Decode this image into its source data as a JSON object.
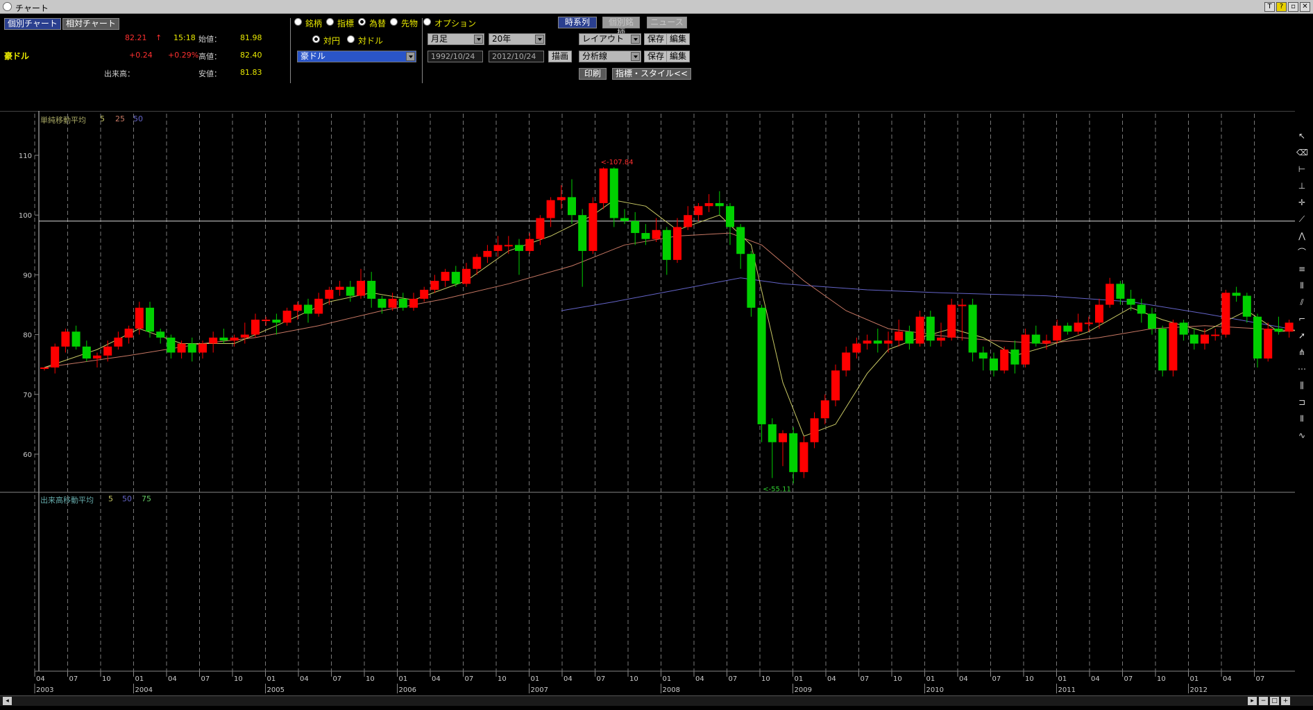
{
  "window": {
    "title": "チャート"
  },
  "tabs": [
    "個別チャート",
    "相対チャート"
  ],
  "quote": {
    "symbol": "豪ドル",
    "price": "82.21",
    "arrow": "↑",
    "time": "15:18",
    "change": "+0.24",
    "change_pct": "+0.29%",
    "volume_label": "出来高：",
    "open_label": "始値：",
    "open": "81.98",
    "high_label": "高値：",
    "high": "82.40",
    "low_label": "安値：",
    "low": "81.83"
  },
  "category_radios": [
    "銘柄",
    "指標",
    "為替",
    "先物",
    "オプション"
  ],
  "currency_radios": [
    "対円",
    "対ドル"
  ],
  "pair_select": "豪ドル",
  "period": {
    "interval": "月足",
    "span": "20年",
    "from": "1992/10/24",
    "to": "2012/10/24",
    "draw": "描画"
  },
  "right_buttons": {
    "timeseries": "時系列",
    "individual": "個別銘柄",
    "news": "ニュース",
    "layout": "レイアウト",
    "save": "保存",
    "edit": "編集",
    "analysis": "分析線",
    "print": "印刷",
    "indicator_style": "指標・スタイル<<"
  },
  "legends": {
    "sma_title": "単純移動平均",
    "sma_periods": [
      "5",
      "25",
      "50"
    ],
    "vol_title": "出来高移動平均",
    "vol_periods": [
      "5",
      "50",
      "75"
    ]
  },
  "annotations": {
    "high": "<-107.84",
    "low": "<-55.11"
  },
  "tools": [
    "cursor-icon",
    "eraser-icon",
    "hline-icon",
    "vline-icon",
    "crosshair-icon",
    "trendline-icon",
    "fan-icon",
    "arc-icon",
    "retracement-icon",
    "cycle-icon",
    "channel-icon",
    "fib-icon",
    "ray-icon",
    "gann-icon",
    "zigzag-icon",
    "time-zone-icon",
    "bracket-icon",
    "split-icon",
    "wave-icon"
  ],
  "chart_data": {
    "type": "candlestick",
    "title": "",
    "y_ticks": [
      110,
      100,
      90,
      80,
      70,
      60
    ],
    "ylim": [
      50,
      112
    ],
    "horizontal_line": 99,
    "x_ticks": [
      "04",
      "07",
      "10",
      "01",
      "04",
      "07",
      "10",
      "01",
      "04",
      "07",
      "10",
      "01",
      "04",
      "07",
      "10",
      "01",
      "04",
      "07",
      "10",
      "01",
      "04",
      "07",
      "10",
      "01",
      "04",
      "07",
      "10",
      "01",
      "04",
      "07",
      "10",
      "01",
      "04",
      "07",
      "10",
      "01",
      "04",
      "07"
    ],
    "x_years": [
      {
        "label": "2003",
        "at": 0
      },
      {
        "label": "2004",
        "at": 3
      },
      {
        "label": "2005",
        "at": 7
      },
      {
        "label": "2006",
        "at": 11
      },
      {
        "label": "2007",
        "at": 15
      },
      {
        "label": "2008",
        "at": 19
      },
      {
        "label": "2009",
        "at": 23
      },
      {
        "label": "2010",
        "at": 27
      },
      {
        "label": "2011",
        "at": 31
      },
      {
        "label": "2012",
        "at": 35
      }
    ],
    "colors": {
      "up": "#ff0000",
      "down": "#00d000",
      "ma5": "#c8c864",
      "ma25": "#c87864",
      "ma50": "#6464c8"
    },
    "candles": [
      [
        74.5,
        74.5,
        74.5,
        74.0
      ],
      [
        74.5,
        78.0,
        73.5,
        78.5
      ],
      [
        78.0,
        80.5,
        77.0,
        81.0
      ],
      [
        80.5,
        78.0,
        77.5,
        81.5
      ],
      [
        78.0,
        76.0,
        75.5,
        79.0
      ],
      [
        76.0,
        76.5,
        74.5,
        77.0
      ],
      [
        76.5,
        78.0,
        75.5,
        79.0
      ],
      [
        78.0,
        79.5,
        77.5,
        80.5
      ],
      [
        79.5,
        81.0,
        78.5,
        81.5
      ],
      [
        81.0,
        84.5,
        80.0,
        85.5
      ],
      [
        84.5,
        80.5,
        79.5,
        85.5
      ],
      [
        80.5,
        79.5,
        78.5,
        81.0
      ],
      [
        79.5,
        77.0,
        76.0,
        80.0
      ],
      [
        77.0,
        78.5,
        76.0,
        79.0
      ],
      [
        78.5,
        77.0,
        75.5,
        79.5
      ],
      [
        77.0,
        78.5,
        76.0,
        79.0
      ],
      [
        78.5,
        79.5,
        77.0,
        80.5
      ],
      [
        79.5,
        79.0,
        78.5,
        81.0
      ],
      [
        79.0,
        79.5,
        78.0,
        80.0
      ],
      [
        79.5,
        80.0,
        78.5,
        82.0
      ],
      [
        80.0,
        82.5,
        79.5,
        83.5
      ],
      [
        82.5,
        82.5,
        81.5,
        83.0
      ],
      [
        82.5,
        82.0,
        80.0,
        83.5
      ],
      [
        82.0,
        84.0,
        81.5,
        84.5
      ],
      [
        84.0,
        85.0,
        82.5,
        85.5
      ],
      [
        85.0,
        83.5,
        82.0,
        86.0
      ],
      [
        83.5,
        86.0,
        83.0,
        87.0
      ],
      [
        86.0,
        87.5,
        85.0,
        88.0
      ],
      [
        87.5,
        88.0,
        86.5,
        89.0
      ],
      [
        88.0,
        86.5,
        85.5,
        89.0
      ],
      [
        86.5,
        89.0,
        86.0,
        91.0
      ],
      [
        89.0,
        86.0,
        84.5,
        90.5
      ],
      [
        86.0,
        84.5,
        83.5,
        86.5
      ],
      [
        84.5,
        86.0,
        84.0,
        87.0
      ],
      [
        86.0,
        84.5,
        84.0,
        87.0
      ],
      [
        84.5,
        86.0,
        84.0,
        87.0
      ],
      [
        86.0,
        87.5,
        85.5,
        88.0
      ],
      [
        87.5,
        89.0,
        87.0,
        90.0
      ],
      [
        89.0,
        90.5,
        88.0,
        91.0
      ],
      [
        90.5,
        88.5,
        88.0,
        91.5
      ],
      [
        88.5,
        91.0,
        88.0,
        92.0
      ],
      [
        91.0,
        93.0,
        90.0,
        93.5
      ],
      [
        93.0,
        94.0,
        92.0,
        95.0
      ],
      [
        94.0,
        95.0,
        93.0,
        96.5
      ],
      [
        95.0,
        95.0,
        93.5,
        96.5
      ],
      [
        95.0,
        94.0,
        90.0,
        96.0
      ],
      [
        94.0,
        96.0,
        93.5,
        97.0
      ],
      [
        96.0,
        99.5,
        95.0,
        100.0
      ],
      [
        99.5,
        102.5,
        98.0,
        103.0
      ],
      [
        102.5,
        103.0,
        101.0,
        105.0
      ],
      [
        103.0,
        100.0,
        98.5,
        106.0
      ],
      [
        100.0,
        94.0,
        88.0,
        101.0
      ],
      [
        94.0,
        102.0,
        93.5,
        103.0
      ],
      [
        102.0,
        107.8,
        101.0,
        108.0
      ],
      [
        107.8,
        99.5,
        98.0,
        108.0
      ],
      [
        99.5,
        99.0,
        98.5,
        101.0
      ],
      [
        99.0,
        97.0,
        95.0,
        100.5
      ],
      [
        97.0,
        96.0,
        95.0,
        98.5
      ],
      [
        96.0,
        97.5,
        95.5,
        99.5
      ],
      [
        97.5,
        92.5,
        90.0,
        98.0
      ],
      [
        92.5,
        98.0,
        92.0,
        99.5
      ],
      [
        98.0,
        100.0,
        97.5,
        101.5
      ],
      [
        100.0,
        101.5,
        99.0,
        102.0
      ],
      [
        101.5,
        102.0,
        100.5,
        103.5
      ],
      [
        102.0,
        101.5,
        100.0,
        104.0
      ],
      [
        101.5,
        98.0,
        95.0,
        102.0
      ],
      [
        98.0,
        93.5,
        91.0,
        98.5
      ],
      [
        93.5,
        84.5,
        83.0,
        94.0
      ],
      [
        84.5,
        65.0,
        62.0,
        85.0
      ],
      [
        65.0,
        62.0,
        56.0,
        66.0
      ],
      [
        62.0,
        63.5,
        58.0,
        64.0
      ],
      [
        63.5,
        57.0,
        55.1,
        64.5
      ],
      [
        57.0,
        62.0,
        56.0,
        63.0
      ],
      [
        62.0,
        66.0,
        61.0,
        67.0
      ],
      [
        66.0,
        69.0,
        65.0,
        70.0
      ],
      [
        69.0,
        74.0,
        68.0,
        75.0
      ],
      [
        74.0,
        77.0,
        73.0,
        78.0
      ],
      [
        77.0,
        78.5,
        76.0,
        79.5
      ],
      [
        78.5,
        79.0,
        77.5,
        80.0
      ],
      [
        79.0,
        78.5,
        77.0,
        81.0
      ],
      [
        78.5,
        79.0,
        77.0,
        80.5
      ],
      [
        79.0,
        80.5,
        78.0,
        82.5
      ],
      [
        80.5,
        78.5,
        77.5,
        81.5
      ],
      [
        78.5,
        83.0,
        78.0,
        84.0
      ],
      [
        83.0,
        79.0,
        78.0,
        84.0
      ],
      [
        79.0,
        79.5,
        78.0,
        82.0
      ],
      [
        79.5,
        85.0,
        79.0,
        86.0
      ],
      [
        85.0,
        85.0,
        79.0,
        86.0
      ],
      [
        85.0,
        77.0,
        75.5,
        86.0
      ],
      [
        77.0,
        76.0,
        74.0,
        78.0
      ],
      [
        76.0,
        74.0,
        73.0,
        77.0
      ],
      [
        74.0,
        77.5,
        73.5,
        78.0
      ],
      [
        77.5,
        75.0,
        73.5,
        79.0
      ],
      [
        75.0,
        80.0,
        74.5,
        81.0
      ],
      [
        80.0,
        78.5,
        78.0,
        81.5
      ],
      [
        78.5,
        79.0,
        77.5,
        80.0
      ],
      [
        79.0,
        81.5,
        78.5,
        82.5
      ],
      [
        81.5,
        80.5,
        80.0,
        82.0
      ],
      [
        80.5,
        82.0,
        80.0,
        83.5
      ],
      [
        82.0,
        82.0,
        80.5,
        83.0
      ],
      [
        82.0,
        85.0,
        81.0,
        86.0
      ],
      [
        85.0,
        88.5,
        84.5,
        89.5
      ],
      [
        88.5,
        86.0,
        85.0,
        89.0
      ],
      [
        86.0,
        85.0,
        84.0,
        87.5
      ],
      [
        85.0,
        83.5,
        82.0,
        86.0
      ],
      [
        83.5,
        81.0,
        80.0,
        84.5
      ],
      [
        81.0,
        74.0,
        73.0,
        81.5
      ],
      [
        74.0,
        82.0,
        73.0,
        82.5
      ],
      [
        82.0,
        80.0,
        79.0,
        82.5
      ],
      [
        80.0,
        78.5,
        77.5,
        81.0
      ],
      [
        78.5,
        80.0,
        77.5,
        81.0
      ],
      [
        80.0,
        80.0,
        79.0,
        81.0
      ],
      [
        80.0,
        87.0,
        79.5,
        87.5
      ],
      [
        87.0,
        86.5,
        85.5,
        88.0
      ],
      [
        86.5,
        83.0,
        82.0,
        87.0
      ],
      [
        83.0,
        76.0,
        74.5,
        83.5
      ],
      [
        76.0,
        81.0,
        75.5,
        82.0
      ],
      [
        81.0,
        80.5,
        80.0,
        83.0
      ],
      [
        80.5,
        82.0,
        79.5,
        82.5
      ],
      [
        82.0,
        81.0,
        80.0,
        83.0
      ]
    ],
    "ma5": [
      [
        0,
        74.5
      ],
      [
        5,
        77.5
      ],
      [
        9,
        81.0
      ],
      [
        13,
        78.5
      ],
      [
        18,
        78.5
      ],
      [
        22,
        81.5
      ],
      [
        27,
        85.5
      ],
      [
        31,
        87.0
      ],
      [
        35,
        85.8
      ],
      [
        40,
        89.0
      ],
      [
        44,
        94.0
      ],
      [
        48,
        96.5
      ],
      [
        52,
        100.0
      ],
      [
        54,
        102.5
      ],
      [
        57,
        101.5
      ],
      [
        60,
        97.5
      ],
      [
        64,
        100.0
      ],
      [
        67,
        95.0
      ],
      [
        70,
        72.0
      ],
      [
        72,
        63.0
      ],
      [
        75,
        65.0
      ],
      [
        78,
        73.5
      ],
      [
        80,
        77.5
      ],
      [
        83,
        79.5
      ],
      [
        86,
        81.0
      ],
      [
        89,
        79.5
      ],
      [
        92,
        76.5
      ],
      [
        95,
        78.0
      ],
      [
        99,
        80.5
      ],
      [
        103,
        84.5
      ],
      [
        106,
        82.5
      ],
      [
        110,
        80.5
      ],
      [
        114,
        84.0
      ],
      [
        117,
        80.5
      ],
      [
        120,
        81.0
      ]
    ],
    "ma25": [
      [
        0,
        74.5
      ],
      [
        8,
        76.5
      ],
      [
        15,
        78.5
      ],
      [
        20,
        79.5
      ],
      [
        26,
        81.5
      ],
      [
        32,
        84.0
      ],
      [
        38,
        86.0
      ],
      [
        44,
        88.5
      ],
      [
        50,
        91.5
      ],
      [
        55,
        95.0
      ],
      [
        60,
        96.5
      ],
      [
        65,
        97.0
      ],
      [
        68,
        95.0
      ],
      [
        72,
        89.0
      ],
      [
        76,
        84.0
      ],
      [
        80,
        81.0
      ],
      [
        85,
        79.8
      ],
      [
        90,
        79.0
      ],
      [
        95,
        78.5
      ],
      [
        100,
        79.5
      ],
      [
        105,
        81.0
      ],
      [
        110,
        81.5
      ],
      [
        115,
        81.0
      ],
      [
        120,
        80.5
      ]
    ],
    "ma50": [
      [
        49,
        84.0
      ],
      [
        54,
        85.5
      ],
      [
        60,
        87.5
      ],
      [
        66,
        89.5
      ],
      [
        70,
        88.5
      ],
      [
        78,
        87.5
      ],
      [
        85,
        87.0
      ],
      [
        95,
        86.5
      ],
      [
        103,
        85.5
      ],
      [
        110,
        83.5
      ],
      [
        118,
        81.0
      ],
      [
        120,
        80.0
      ]
    ]
  }
}
